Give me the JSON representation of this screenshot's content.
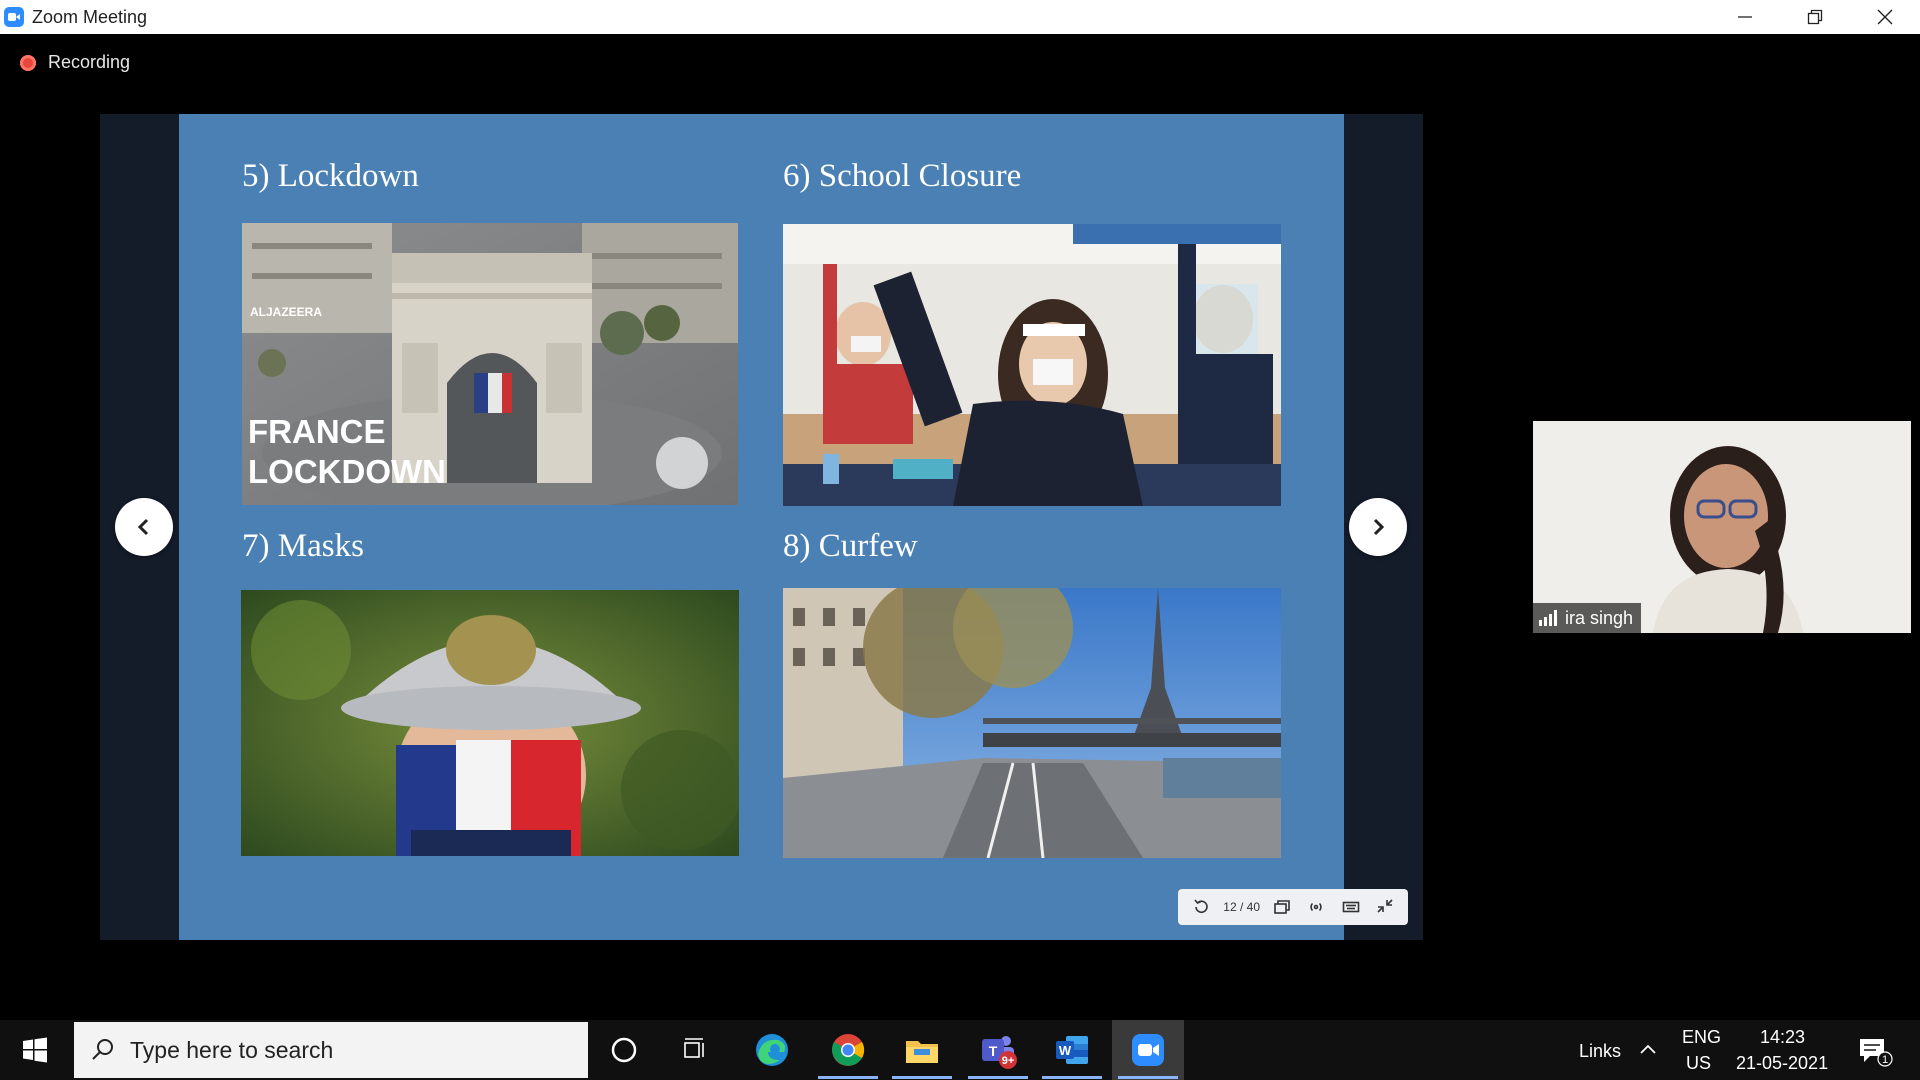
{
  "window": {
    "title": "Zoom Meeting"
  },
  "recording": {
    "label": "Recording"
  },
  "slide": {
    "headings": [
      "5) Lockdown",
      "6) School Closure",
      "7) Masks",
      "8) Curfew"
    ],
    "lockdown_image_text": [
      "ALJAZEERA",
      "FRANCE",
      "LOCKDOWN"
    ],
    "page_counter": "12 / 40"
  },
  "participant": {
    "name": "ira singh"
  },
  "taskbar": {
    "search_placeholder": "Type here to search",
    "teams_badge": "9+",
    "links_label": "Links",
    "language": "ENG",
    "region": "US",
    "time": "14:23",
    "date": "21-05-2021",
    "notification_count": "1"
  },
  "colors": {
    "slide_background": "#4a80b4",
    "zoom_blue": "#2d8cff",
    "recording_red": "#e8463a"
  }
}
